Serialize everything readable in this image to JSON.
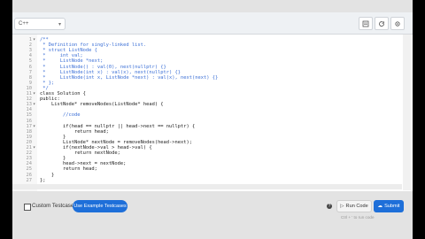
{
  "header": {
    "language": "C++",
    "buttons": [
      {
        "name": "notes-icon"
      },
      {
        "name": "refresh-icon"
      },
      {
        "name": "settings-icon"
      }
    ]
  },
  "code_lines": [
    {
      "ln": "1",
      "fold": "▾",
      "text": "/**",
      "kind": "comment"
    },
    {
      "ln": "2",
      "fold": "",
      "text": " * Definition for singly-linked list.",
      "kind": "comment"
    },
    {
      "ln": "3",
      "fold": "",
      "text": " * struct ListNode {",
      "kind": "comment"
    },
    {
      "ln": "4",
      "fold": "",
      "text": " *     int val;",
      "kind": "comment"
    },
    {
      "ln": "5",
      "fold": "",
      "text": " *     ListNode *next;",
      "kind": "comment"
    },
    {
      "ln": "6",
      "fold": "",
      "text": " *     ListNode() : val(0), next(nullptr) {}",
      "kind": "comment"
    },
    {
      "ln": "7",
      "fold": "",
      "text": " *     ListNode(int x) : val(x), next(nullptr) {}",
      "kind": "comment"
    },
    {
      "ln": "8",
      "fold": "",
      "text": " *     ListNode(int x, ListNode *next) : val(x), next(next) {}",
      "kind": "comment"
    },
    {
      "ln": "9",
      "fold": "",
      "text": " * };",
      "kind": "comment"
    },
    {
      "ln": "10",
      "fold": "",
      "text": " */",
      "kind": "comment"
    },
    {
      "ln": "11",
      "fold": "▾",
      "text": "class Solution {",
      "kind": "default"
    },
    {
      "ln": "12",
      "fold": "",
      "text": "public:",
      "kind": "default"
    },
    {
      "ln": "13",
      "fold": "▾",
      "text": "    ListNode* removeNodes(ListNode* head) {",
      "kind": "default"
    },
    {
      "ln": "14",
      "fold": "",
      "text": "",
      "kind": "default"
    },
    {
      "ln": "15",
      "fold": "",
      "text": "        //code",
      "kind": "comment"
    },
    {
      "ln": "16",
      "fold": "",
      "text": "",
      "kind": "default"
    },
    {
      "ln": "17",
      "fold": "▾",
      "text": "        if(head == nullptr || head->next == nullptr) {",
      "kind": "default"
    },
    {
      "ln": "18",
      "fold": "",
      "text": "            return head;",
      "kind": "default"
    },
    {
      "ln": "19",
      "fold": "",
      "text": "        }",
      "kind": "default"
    },
    {
      "ln": "20",
      "fold": "",
      "text": "        ListNode* nextNode = removeNodes(head->next);",
      "kind": "default"
    },
    {
      "ln": "21",
      "fold": "▾",
      "text": "        if(nextNode->val > head->val) {",
      "kind": "default"
    },
    {
      "ln": "22",
      "fold": "",
      "text": "            return nextNode;",
      "kind": "default"
    },
    {
      "ln": "23",
      "fold": "",
      "text": "        }",
      "kind": "default"
    },
    {
      "ln": "24",
      "fold": "",
      "text": "        head->next = nextNode;",
      "kind": "default"
    },
    {
      "ln": "25",
      "fold": "",
      "text": "        return head;",
      "kind": "default"
    },
    {
      "ln": "26",
      "fold": "",
      "text": "    }",
      "kind": "default"
    },
    {
      "ln": "27",
      "fold": "",
      "text": "};",
      "kind": "default"
    }
  ],
  "footer": {
    "custom_testcase_label": "Custom Testcase",
    "use_example_label": "Use Example Testcases",
    "help_glyph": "?",
    "run_label": "Run Code",
    "submit_label": "Submit",
    "hint": "Ctrl + ' to run code"
  },
  "colors": {
    "accent": "#1e6fd9",
    "comment": "#3b6fd6",
    "code_text": "#222222"
  }
}
